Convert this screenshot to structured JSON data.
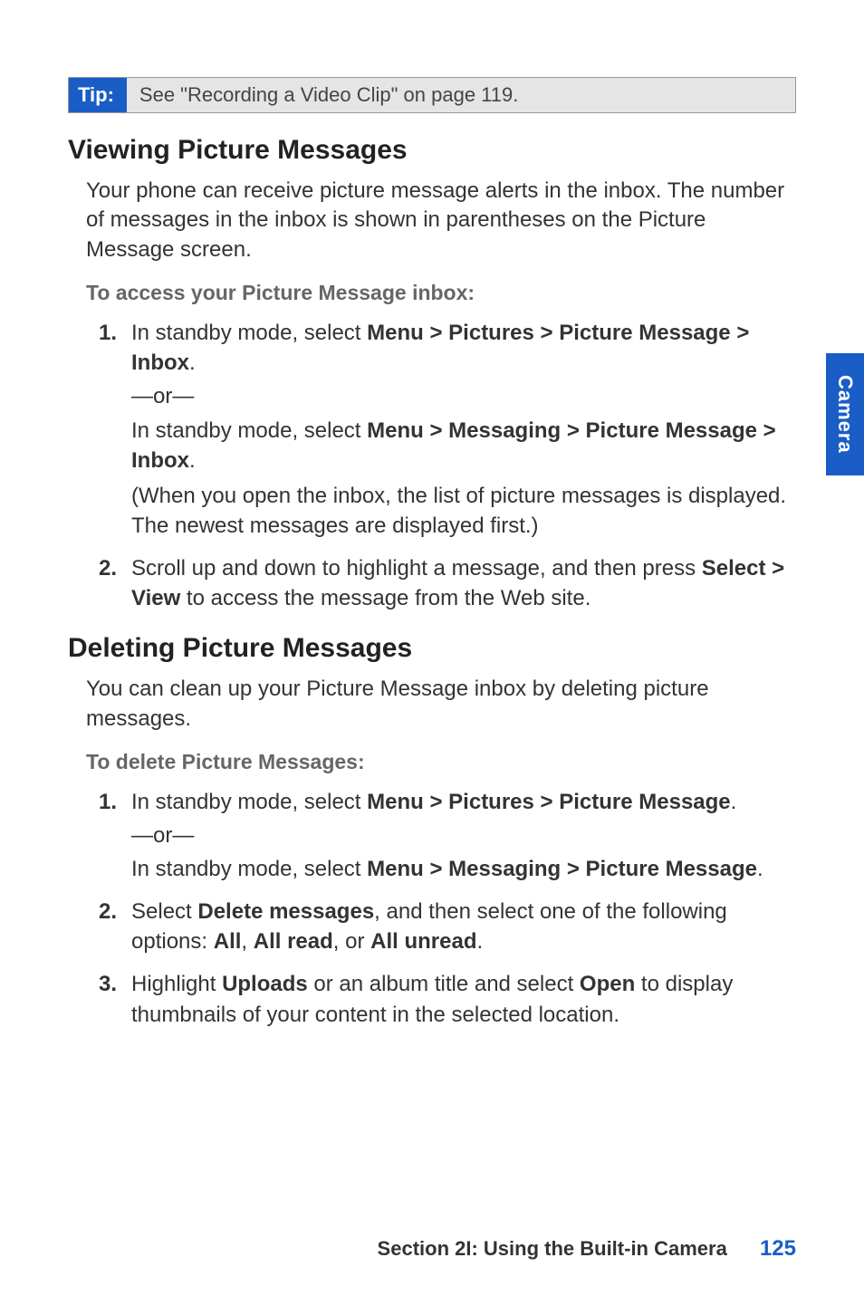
{
  "tip": {
    "label": "Tip:",
    "text": "See \"Recording a Video Clip\" on page 119."
  },
  "section1": {
    "heading": "Viewing Picture Messages",
    "intro": "Your phone can receive picture message alerts in the inbox. The number of messages in the inbox is shown in parentheses on the Picture Message screen.",
    "subheading": "To access your Picture Message inbox:",
    "step1": {
      "num": "1.",
      "pre1": "In standby mode, select ",
      "bold1": "Menu > Pictures > Picture Message > Inbox",
      "or": "—or—",
      "pre2": "In standby mode, select ",
      "bold2": "Menu > Messaging > Picture Message > Inbox",
      "paren": "(When you open the inbox, the list of picture messages is displayed. The newest messages are displayed first.)"
    },
    "step2": {
      "num": "2.",
      "pre": "Scroll up and down to highlight a message, and then press ",
      "bold": "Select > View",
      "post": " to access the message from the Web site."
    }
  },
  "section2": {
    "heading": "Deleting Picture Messages",
    "intro": "You can clean up your Picture Message inbox by deleting picture messages.",
    "subheading": "To delete Picture Messages:",
    "step1": {
      "num": "1.",
      "pre1": "In standby mode, select ",
      "bold1": "Menu > Pictures > Picture Message",
      "or": "—or—",
      "pre2": "In standby mode, select ",
      "bold2": "Menu > Messaging > Picture Message"
    },
    "step2": {
      "num": "2.",
      "pre": "Select ",
      "bold1": "Delete messages",
      "mid1": ", and then select one of the following options: ",
      "opt1": "All",
      "comma": ", ",
      "opt2": "All read",
      "mid2": ", or ",
      "opt3": "All unread",
      "end": "."
    },
    "step3": {
      "num": "3.",
      "pre": "Highlight ",
      "bold1": "Uploads",
      "mid": " or an album title and select ",
      "bold2": "Open",
      "post": " to display thumbnails of your content in the selected location."
    }
  },
  "sideTab": "Camera",
  "footer": {
    "section": "Section 2I:  Using the Built-in Camera",
    "page": "125"
  }
}
